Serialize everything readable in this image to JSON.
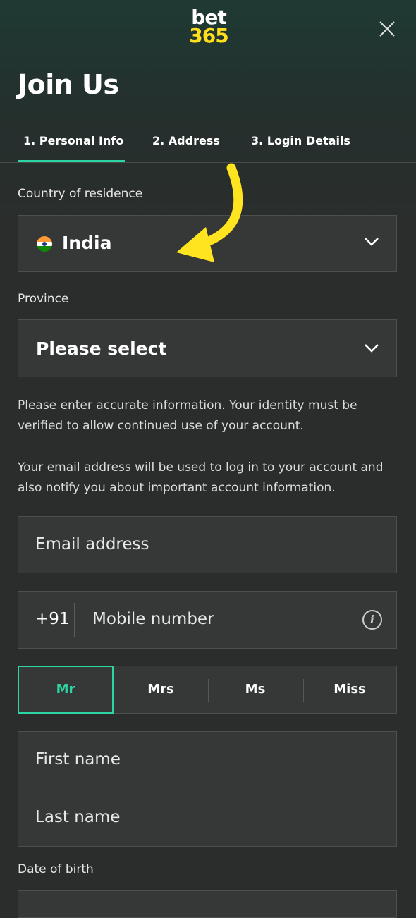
{
  "brand": {
    "logo_top": "bet",
    "logo_bottom": "365"
  },
  "header": {
    "title": "Join Us"
  },
  "tabs": [
    {
      "label": "1. Personal Info",
      "active": true
    },
    {
      "label": "2. Address",
      "active": false
    },
    {
      "label": "3. Login Details",
      "active": false
    }
  ],
  "form": {
    "country_label": "Country of residence",
    "country_value": "India",
    "province_label": "Province",
    "province_value": "Please select",
    "info_text_1": "Please enter accurate information. Your identity must be verified to allow continued use of your account.",
    "info_text_2": "Your email address will be used to log in to your account and also notify you about important account information.",
    "email_placeholder": "Email address",
    "phone_prefix": "+91",
    "mobile_placeholder": "Mobile number",
    "titles": [
      "Mr",
      "Mrs",
      "Ms",
      "Miss"
    ],
    "selected_title": "Mr",
    "first_name_placeholder": "First name",
    "last_name_placeholder": "Last name",
    "dob_label": "Date of birth"
  },
  "colors": {
    "accent": "#2dd4a4",
    "brand_yellow": "#ffdf1b",
    "arrow_yellow": "#ffe41f"
  },
  "icons": [
    "close-icon",
    "india-flag-icon",
    "chevron-down-icon",
    "info-icon",
    "annotation-arrow"
  ]
}
